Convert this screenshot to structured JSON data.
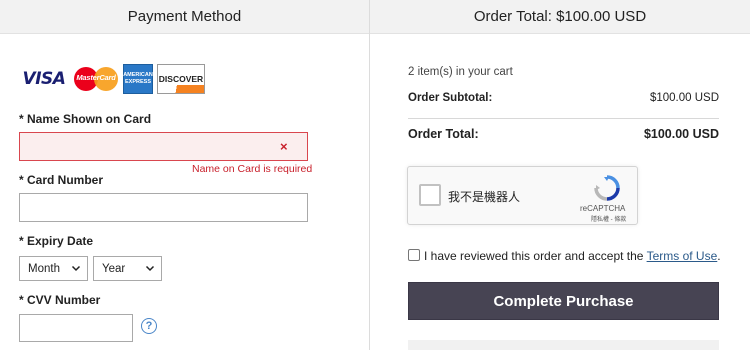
{
  "left_header": "Payment Method",
  "right_header": "Order Total: $100.00 USD",
  "card_logos": [
    {
      "name": "visa-logo",
      "text": "VISA"
    },
    {
      "name": "mastercard-logo",
      "text": "MasterCard"
    },
    {
      "name": "amex-logo",
      "text": "AMERICAN EXPRESS"
    },
    {
      "name": "discover-logo",
      "text": "DISCOVER"
    }
  ],
  "fields": {
    "name_label": "* Name Shown on Card",
    "name_value": "",
    "name_error_icon": "×",
    "name_error": "Name on Card is required",
    "card_number_label": "* Card Number",
    "card_number_value": "",
    "expiry_label": "* Expiry Date",
    "month_selected": "Month",
    "year_selected": "Year",
    "cvv_label": "* CVV Number",
    "cvv_value": "",
    "cvv_help": "?"
  },
  "summary": {
    "items_text": "2 item(s) in your cart",
    "subtotal_label": "Order Subtotal:",
    "subtotal_value": "$100.00 USD",
    "total_label": "Order Total:",
    "total_value": "$100.00 USD"
  },
  "recaptcha": {
    "checkbox_text": "我不是機器人",
    "brand": "reCAPTCHA",
    "links": "隱私權 - 條款"
  },
  "accept": {
    "text_before": "I have reviewed this order and accept the ",
    "link_text": "Terms of Use",
    "text_after": ".",
    "checked": false
  },
  "complete_button": "Complete Purchase",
  "colors": {
    "error": "#c8202b",
    "button_bg": "#474453",
    "link": "#2b5a8a",
    "header_bg": "#f2f2f2"
  }
}
